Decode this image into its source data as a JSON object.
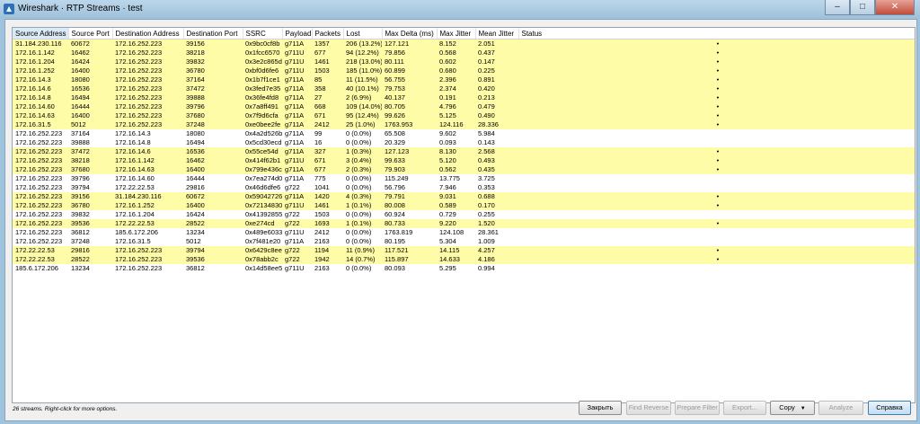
{
  "window": {
    "title": "Wireshark · RTP Streams · test",
    "minimize_glyph": "–",
    "maximize_glyph": "□",
    "close_glyph": "✕"
  },
  "columns": [
    "Source Address",
    "Source Port",
    "Destination Address",
    "Destination Port",
    "SSRC",
    "Payload",
    "Packets",
    "Lost",
    "Max Delta (ms)",
    "Max Jitter",
    "Mean Jitter",
    "Status"
  ],
  "rows": [
    {
      "hl": true,
      "c": [
        "31.184.230.116",
        "60672",
        "172.16.252.223",
        "39156",
        "0x9bc0cf8b",
        "g711A",
        "1357",
        "206 (13.2%)",
        "127.121",
        "8.152",
        "2.051",
        "•"
      ]
    },
    {
      "hl": true,
      "c": [
        "172.16.1.142",
        "16462",
        "172.16.252.223",
        "38218",
        "0x1fcc6570",
        "g711U",
        "677",
        "94 (12.2%)",
        "79.856",
        "0.568",
        "0.437",
        "•"
      ]
    },
    {
      "hl": true,
      "c": [
        "172.16.1.204",
        "16424",
        "172.16.252.223",
        "39832",
        "0x3e2c865d",
        "g711U",
        "1461",
        "218 (13.0%)",
        "80.111",
        "0.602",
        "0.147",
        "•"
      ]
    },
    {
      "hl": true,
      "c": [
        "172.16.1.252",
        "16400",
        "172.16.252.223",
        "36780",
        "0xbf0d6fe6",
        "g711U",
        "1503",
        "185 (11.0%)",
        "60.899",
        "0.680",
        "0.225",
        "•"
      ]
    },
    {
      "hl": true,
      "c": [
        "172.16.14.3",
        "18080",
        "172.16.252.223",
        "37164",
        "0x1b7f1ce1",
        "g711A",
        "85",
        "11 (11.5%)",
        "56.755",
        "2.396",
        "0.891",
        "•"
      ]
    },
    {
      "hl": true,
      "c": [
        "172.16.14.6",
        "16536",
        "172.16.252.223",
        "37472",
        "0x3fed7e35",
        "g711A",
        "358",
        "40 (10.1%)",
        "79.753",
        "2.374",
        "0.420",
        "•"
      ]
    },
    {
      "hl": true,
      "c": [
        "172.16.14.8",
        "16494",
        "172.16.252.223",
        "39888",
        "0x36fe4fd8",
        "g711A",
        "27",
        "2 (6.9%)",
        "40.137",
        "0.191",
        "0.213",
        "•"
      ]
    },
    {
      "hl": true,
      "c": [
        "172.16.14.60",
        "16444",
        "172.16.252.223",
        "39796",
        "0x7a8ff491",
        "g711A",
        "668",
        "109 (14.0%)",
        "80.705",
        "4.796",
        "0.479",
        "•"
      ]
    },
    {
      "hl": true,
      "c": [
        "172.16.14.63",
        "16400",
        "172.16.252.223",
        "37680",
        "0x7f9d6cfa",
        "g711A",
        "671",
        "95 (12.4%)",
        "99.626",
        "5.125",
        "0.490",
        "•"
      ]
    },
    {
      "hl": true,
      "c": [
        "172.16.31.5",
        "5012",
        "172.16.252.223",
        "37248",
        "0xe0bee2fe",
        "g711A",
        "2412",
        "25 (1.0%)",
        "1763.953",
        "124.116",
        "28.336",
        "•"
      ]
    },
    {
      "hl": false,
      "c": [
        "172.16.252.223",
        "37164",
        "172.16.14.3",
        "18080",
        "0x4a2d526b",
        "g711A",
        "99",
        "0 (0.0%)",
        "65.508",
        "9.602",
        "5.984",
        ""
      ]
    },
    {
      "hl": false,
      "c": [
        "172.16.252.223",
        "39888",
        "172.16.14.8",
        "16494",
        "0x5cd30ecd",
        "g711A",
        "16",
        "0 (0.0%)",
        "20.329",
        "0.093",
        "0.143",
        ""
      ]
    },
    {
      "hl": true,
      "c": [
        "172.16.252.223",
        "37472",
        "172.16.14.6",
        "16536",
        "0x55ce54d",
        "g711A",
        "327",
        "1 (0.3%)",
        "127.123",
        "8.130",
        "2.568",
        "•"
      ]
    },
    {
      "hl": true,
      "c": [
        "172.16.252.223",
        "38218",
        "172.16.1.142",
        "16462",
        "0x414f62b1",
        "g711U",
        "671",
        "3 (0.4%)",
        "99.633",
        "5.120",
        "0.493",
        "•"
      ]
    },
    {
      "hl": true,
      "c": [
        "172.16.252.223",
        "37680",
        "172.16.14.63",
        "16400",
        "0x799e436c",
        "g711A",
        "677",
        "2 (0.3%)",
        "79.903",
        "0.562",
        "0.435",
        "•"
      ]
    },
    {
      "hl": false,
      "c": [
        "172.16.252.223",
        "39796",
        "172.16.14.60",
        "16444",
        "0x7ea274d0",
        "g711A",
        "775",
        "0 (0.0%)",
        "115.249",
        "13.775",
        "3.725",
        ""
      ]
    },
    {
      "hl": false,
      "c": [
        "172.16.252.223",
        "39794",
        "172.22.22.53",
        "29816",
        "0x46d6dfe6",
        "g722",
        "1041",
        "0 (0.0%)",
        "56.796",
        "7.946",
        "0.353",
        ""
      ]
    },
    {
      "hl": true,
      "c": [
        "172.16.252.223",
        "39156",
        "31.184.230.116",
        "60672",
        "0x59042726",
        "g711A",
        "1420",
        "4 (0.3%)",
        "79.791",
        "9.031",
        "0.688",
        "•"
      ]
    },
    {
      "hl": true,
      "c": [
        "172.16.252.223",
        "36780",
        "172.16.1.252",
        "16400",
        "0x72134830",
        "g711U",
        "1461",
        "1 (0.1%)",
        "80.008",
        "0.589",
        "0.170",
        "•"
      ]
    },
    {
      "hl": false,
      "c": [
        "172.16.252.223",
        "39832",
        "172.16.1.204",
        "16424",
        "0x41392855",
        "g722",
        "1503",
        "0 (0.0%)",
        "60.924",
        "0.729",
        "0.255",
        ""
      ]
    },
    {
      "hl": true,
      "c": [
        "172.16.252.223",
        "39536",
        "172.22.22.53",
        "28522",
        "0xe274cd",
        "g722",
        "1693",
        "1 (0.1%)",
        "80.733",
        "9.220",
        "1.520",
        "•"
      ]
    },
    {
      "hl": false,
      "c": [
        "172.16.252.223",
        "36812",
        "185.6.172.206",
        "13234",
        "0x489e6033",
        "g711U",
        "2412",
        "0 (0.0%)",
        "1763.819",
        "124.108",
        "28.361",
        ""
      ]
    },
    {
      "hl": false,
      "c": [
        "172.16.252.223",
        "37248",
        "172.16.31.5",
        "5012",
        "0x7f481e20",
        "g711A",
        "2163",
        "0 (0.0%)",
        "80.195",
        "5.304",
        "1.009",
        ""
      ]
    },
    {
      "hl": true,
      "c": [
        "172.22.22.53",
        "29816",
        "172.16.252.223",
        "39794",
        "0x6429c8ee",
        "g722",
        "1194",
        "11 (0.9%)",
        "117.521",
        "14.115",
        "4.257",
        "•"
      ]
    },
    {
      "hl": true,
      "c": [
        "172.22.22.53",
        "28522",
        "172.16.252.223",
        "39536",
        "0x78abb2c",
        "g722",
        "1942",
        "14 (0.7%)",
        "115.897",
        "14.633",
        "4.186",
        "•"
      ]
    },
    {
      "hl": false,
      "c": [
        "185.6.172.206",
        "13234",
        "172.16.252.223",
        "36812",
        "0x14d58ee5",
        "g711U",
        "2163",
        "0 (0.0%)",
        "80.093",
        "5.295",
        "0.994",
        ""
      ]
    }
  ],
  "status_text": "26 streams. Right-click for more options.",
  "buttons": {
    "close": "Закрыть",
    "find_reverse": "Find Reverse",
    "prepare_filter": "Prepare Filter",
    "export": "Export...",
    "copy": "Copy",
    "copy_caret": "▼",
    "analyze": "Analyze",
    "help": "Справка"
  },
  "colors": {
    "highlight": "#fffca8",
    "title_bar": "#9fc1da"
  }
}
